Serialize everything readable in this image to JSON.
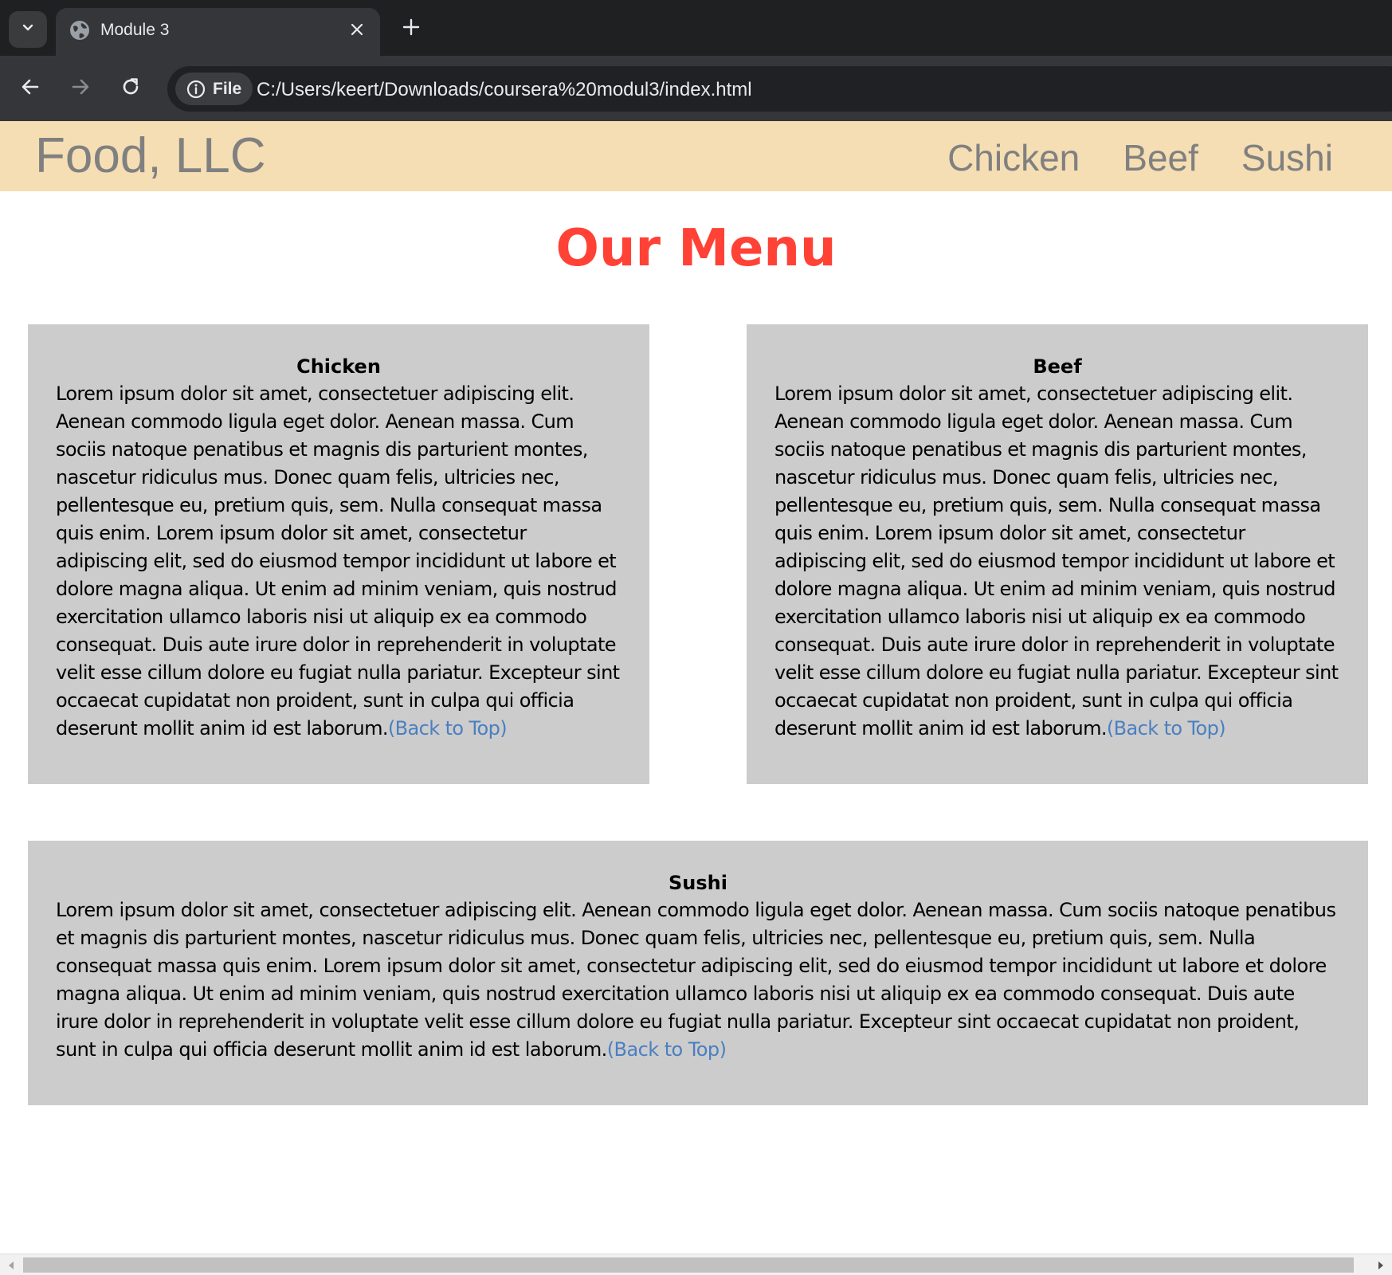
{
  "browser": {
    "tab_title": "Module 3",
    "chip_label": "File",
    "url": "C:/Users/keert/Downloads/coursera%20modul3/index.html"
  },
  "site": {
    "logo": "Food, LLC",
    "nav": [
      "Chicken",
      "Beef",
      "Sushi"
    ],
    "menu_title": "Our Menu"
  },
  "sections": {
    "chicken": {
      "title": "Chicken",
      "body": "Lorem ipsum dolor sit amet, consectetuer adipiscing elit. Aenean commodo ligula eget dolor. Aenean massa. Cum sociis natoque penatibus et magnis dis parturient montes, nascetur ridiculus mus. Donec quam felis, ultricies nec, pellentesque eu, pretium quis, sem. Nulla consequat massa quis enim. Lorem ipsum dolor sit amet, consectetur adipiscing elit, sed do eiusmod tempor incididunt ut labore et dolore magna aliqua. Ut enim ad minim veniam, quis nostrud exercitation ullamco laboris nisi ut aliquip ex ea commodo consequat. Duis aute irure dolor in reprehenderit in voluptate velit esse cillum dolore eu fugiat nulla pariatur. Excepteur sint occaecat cupidatat non proident, sunt in culpa qui officia deserunt mollit anim id est laborum.",
      "link": "(Back to Top)"
    },
    "beef": {
      "title": "Beef",
      "body": "Lorem ipsum dolor sit amet, consectetuer adipiscing elit. Aenean commodo ligula eget dolor. Aenean massa. Cum sociis natoque penatibus et magnis dis parturient montes, nascetur ridiculus mus. Donec quam felis, ultricies nec, pellentesque eu, pretium quis, sem. Nulla consequat massa quis enim. Lorem ipsum dolor sit amet, consectetur adipiscing elit, sed do eiusmod tempor incididunt ut labore et dolore magna aliqua. Ut enim ad minim veniam, quis nostrud exercitation ullamco laboris nisi ut aliquip ex ea commodo consequat. Duis aute irure dolor in reprehenderit in voluptate velit esse cillum dolore eu fugiat nulla pariatur. Excepteur sint occaecat cupidatat non proident, sunt in culpa qui officia deserunt mollit anim id est laborum.",
      "link": "(Back to Top)"
    },
    "sushi": {
      "title": "Sushi",
      "body": "Lorem ipsum dolor sit amet, consectetuer adipiscing elit. Aenean commodo ligula eget dolor. Aenean massa. Cum sociis natoque penatibus et magnis dis parturient montes, nascetur ridiculus mus. Donec quam felis, ultricies nec, pellentesque eu, pretium quis, sem. Nulla consequat massa quis enim. Lorem ipsum dolor sit amet, consectetur adipiscing elit, sed do eiusmod tempor incididunt ut labore et dolore magna aliqua. Ut enim ad minim veniam, quis nostrud exercitation ullamco laboris nisi ut aliquip ex ea commodo consequat. Duis aute irure dolor in reprehenderit in voluptate velit esse cillum dolore eu fugiat nulla pariatur. Excepteur sint occaecat cupidatat non proident, sunt in culpa qui officia deserunt mollit anim id est laborum.",
      "link": "(Back to Top)"
    }
  },
  "icons": {
    "tab_menu": "chevron-down-icon",
    "favicon": "globe-icon",
    "tab_close": "close-icon",
    "new_tab": "plus-icon",
    "back": "arrow-left-icon",
    "forward": "arrow-right-icon",
    "reload": "reload-icon",
    "site_info": "info-icon"
  },
  "colors": {
    "header_bg": "#f5deb3",
    "title_red": "#ff4136",
    "card_bg": "#cccccc",
    "link_blue": "#4a7fc1"
  }
}
